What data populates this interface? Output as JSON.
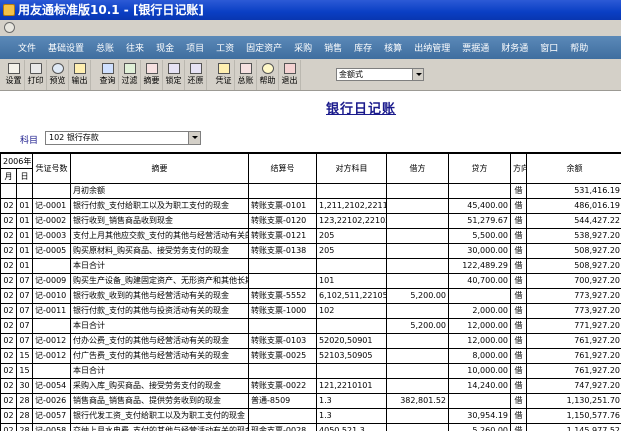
{
  "window": {
    "title": "用友通标准版10.1 - [银行日记账]"
  },
  "menu": [
    "文件",
    "基础设置",
    "总账",
    "往来",
    "现金",
    "项目",
    "工资",
    "固定资产",
    "采购",
    "销售",
    "库存",
    "核算",
    "出纳管理",
    "票据通",
    "财务通",
    "窗口",
    "帮助"
  ],
  "toolbar": {
    "buttons": [
      {
        "label": "设置",
        "icon": "setup-icon"
      },
      {
        "label": "打印",
        "icon": "printer-icon"
      },
      {
        "label": "预览",
        "icon": "preview-icon"
      },
      {
        "label": "输出",
        "icon": "export-icon"
      },
      {
        "label": "查询",
        "icon": "binoculars-icon"
      },
      {
        "label": "过滤",
        "icon": "filter-icon"
      },
      {
        "label": "摘要",
        "icon": "summary-icon"
      },
      {
        "label": "锁定",
        "icon": "lock-icon"
      },
      {
        "label": "还原",
        "icon": "restore-icon"
      },
      {
        "label": "凭证",
        "icon": "voucher-icon"
      },
      {
        "label": "总账",
        "icon": "ledger-icon"
      },
      {
        "label": "帮助",
        "icon": "help-icon"
      },
      {
        "label": "退出",
        "icon": "exit-icon"
      }
    ],
    "format_select": "金额式"
  },
  "report": {
    "title": "银行日记账"
  },
  "filter": {
    "subject_label": "科目",
    "subject_value": "102 银行存款"
  },
  "table": {
    "year": "2006年",
    "headers": {
      "month": "月",
      "day": "日",
      "voucher": "凭证号数",
      "summary": "摘要",
      "settlement": "结算号",
      "contra": "对方科目",
      "debit": "借方",
      "credit": "贷方",
      "direction": "方向",
      "balance": "余额"
    },
    "rows": [
      {
        "m": "",
        "d": "",
        "v": "",
        "s": "月初余额",
        "st": "",
        "cs": "",
        "dr": "",
        "cr": "",
        "dir": "借",
        "bal": "531,416.19"
      },
      {
        "m": "02",
        "d": "01",
        "v": "记-0001",
        "s": "银行付款_支付给职工以及为职工支付的现金",
        "st": "转账支票-0101",
        "cs": "1,211,2102,2211",
        "dr": "",
        "cr": "45,400.00",
        "dir": "借",
        "bal": "486,016.19"
      },
      {
        "m": "02",
        "d": "01",
        "v": "记-0002",
        "s": "银行收到_销售商品收到现金",
        "st": "转账支票-0120",
        "cs": "123,22102,22103",
        "dr": "",
        "cr": "51,279.67",
        "dir": "借",
        "bal": "544,427.22"
      },
      {
        "m": "02",
        "d": "01",
        "v": "记-0003",
        "s": "支付上月其他应交款_支付的其他与经营活动有关的现金",
        "st": "转账支票-0121",
        "cs": "205",
        "dr": "",
        "cr": "5,500.00",
        "dir": "借",
        "bal": "538,927.20"
      },
      {
        "m": "02",
        "d": "01",
        "v": "记-0005",
        "s": "购买原材料_购买商品、接受劳务支付的现金",
        "st": "转账支票-0138",
        "cs": "205",
        "dr": "",
        "cr": "30,000.00",
        "dir": "借",
        "bal": "508,927.20"
      },
      {
        "m": "02",
        "d": "01",
        "v": "",
        "s": "本日合计",
        "st": "",
        "cs": "",
        "dr": "",
        "cr": "122,489.29",
        "dir": "借",
        "bal": "508,927.20"
      },
      {
        "m": "02",
        "d": "07",
        "v": "记-0009",
        "s": "购买生产设备_购建固定资产、无形资产和其他长期",
        "st": "",
        "cs": "101",
        "dr": "",
        "cr": "40,700.00",
        "dir": "借",
        "bal": "700,927.20"
      },
      {
        "m": "02",
        "d": "07",
        "v": "记-0010",
        "s": "银行收款_收到的其他与经营活动有关的现金",
        "st": "转账支票-5552",
        "cs": "6,102,511,22105",
        "dr": "5,200.00",
        "cr": "",
        "dir": "借",
        "bal": "773,927.20"
      },
      {
        "m": "02",
        "d": "07",
        "v": "记-0011",
        "s": "银行付款_支付的其他与投资活动有关的现金",
        "st": "转账支票-1000",
        "cs": "102",
        "dr": "",
        "cr": "2,000.00",
        "dir": "借",
        "bal": "773,927.20"
      },
      {
        "m": "02",
        "d": "07",
        "v": "",
        "s": "本日合计",
        "st": "",
        "cs": "",
        "dr": "5,200.00",
        "cr": "12,000.00",
        "dir": "借",
        "bal": "771,927.20"
      },
      {
        "m": "02",
        "d": "07",
        "v": "记-0012",
        "s": "付办公费_支付的其他与经营活动有关的现金",
        "st": "转账支票-0103",
        "cs": "52020,50901",
        "dr": "",
        "cr": "12,000.00",
        "dir": "借",
        "bal": "761,927.20"
      },
      {
        "m": "02",
        "d": "15",
        "v": "记-0012",
        "s": "付广告费_支付的其他与经营活动有关的现金",
        "st": "转账支票-0025",
        "cs": "52103,50905",
        "dr": "",
        "cr": "8,000.00",
        "dir": "借",
        "bal": "761,927.20"
      },
      {
        "m": "02",
        "d": "15",
        "v": "",
        "s": "本日合计",
        "st": "",
        "cs": "",
        "dr": "",
        "cr": "10,000.00",
        "dir": "借",
        "bal": "761,927.20"
      },
      {
        "m": "02",
        "d": "30",
        "v": "记-0054",
        "s": "采购入库_购买商品、接受劳务支付的现金",
        "st": "转账支票-0022",
        "cs": "121,2210101",
        "dr": "",
        "cr": "14,240.00",
        "dir": "借",
        "bal": "747,927.20"
      },
      {
        "m": "02",
        "d": "28",
        "v": "记-0026",
        "s": "销售商品_销售商品、提供劳务收到的现金",
        "st": "普通-8509",
        "cs": "1.3",
        "dr": "382,801.52",
        "cr": "",
        "dir": "借",
        "bal": "1,130,251.70"
      },
      {
        "m": "02",
        "d": "28",
        "v": "记-0057",
        "s": "银行代发工资_支付给职工以及为职工支付的现金",
        "st": "",
        "cs": "1.3",
        "dr": "",
        "cr": "30,954.19",
        "dir": "借",
        "bal": "1,150,577.76"
      },
      {
        "m": "02",
        "d": "28",
        "v": "记-0058",
        "s": "交纳上月水电费_支付的其他与经营活动有关的现金",
        "st": "现金支票-0028",
        "cs": "4050,521.3",
        "dr": "",
        "cr": "5,260.00",
        "dir": "借",
        "bal": "1,145,977.52"
      }
    ]
  }
}
